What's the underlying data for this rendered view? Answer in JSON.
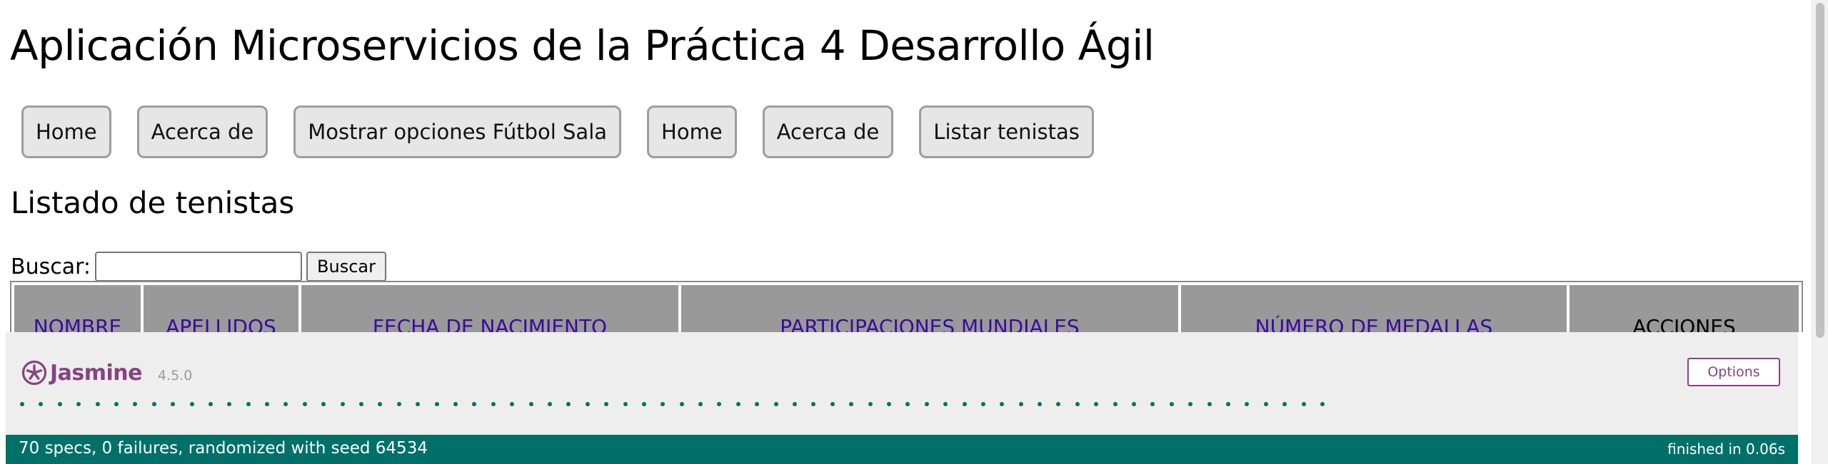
{
  "header": {
    "title": "Aplicación Microservicios de la Práctica 4 Desarrollo Ágil"
  },
  "nav": {
    "items": [
      {
        "label": "Home"
      },
      {
        "label": "Acerca de"
      },
      {
        "label": "Mostrar opciones Fútbol Sala"
      },
      {
        "label": "Home"
      },
      {
        "label": "Acerca de"
      },
      {
        "label": "Listar tenistas"
      }
    ]
  },
  "section": {
    "title": "Listado de tenistas"
  },
  "search": {
    "label": "Buscar:",
    "value": "",
    "button_label": "Buscar"
  },
  "table": {
    "columns": [
      {
        "label": "NOMBRE",
        "sortable": true
      },
      {
        "label": "APELLIDOS",
        "sortable": true
      },
      {
        "label": "FECHA DE NACIMIENTO",
        "sortable": true
      },
      {
        "label": "PARTICIPACIONES MUNDIALES",
        "sortable": true
      },
      {
        "label": "NÚMERO DE MEDALLAS",
        "sortable": true
      },
      {
        "label": "ACCIONES",
        "sortable": false
      }
    ]
  },
  "jasmine": {
    "name": "Jasmine",
    "version": "4.5.0",
    "options_label": "Options",
    "passed_spec_dots": 70,
    "summary": "70 specs, 0 failures, randomized with seed 64534",
    "duration": "finished in 0.06s",
    "colors": {
      "brand": "#8a4182",
      "passed": "#007069"
    }
  }
}
